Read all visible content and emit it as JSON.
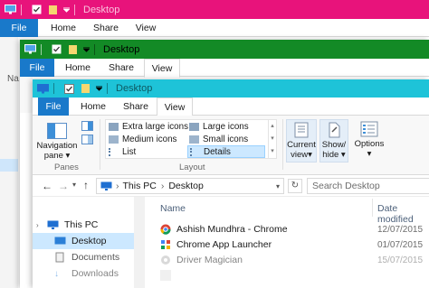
{
  "colors": {
    "pink": "#e8137b",
    "green": "#138a26",
    "cyan": "#1ec3d8",
    "file_tab": "#1979ca",
    "selection": "#cce8ff"
  },
  "back_window": {
    "title": "Desktop",
    "tabs": [
      "File",
      "Home",
      "Share",
      "View"
    ]
  },
  "middle_window": {
    "title": "Desktop",
    "tabs": [
      "File",
      "Home",
      "Share",
      "View"
    ],
    "edge_label": "Na"
  },
  "front_window": {
    "title": "Desktop",
    "tabs": {
      "file": "File",
      "home": "Home",
      "share": "Share",
      "view": "View"
    },
    "panes": {
      "navigation_pane_line1": "Navigation",
      "navigation_pane_line2": "pane",
      "group_label": "Panes"
    },
    "layout": {
      "group_label": "Layout",
      "items": [
        "Extra large icons",
        "Large icons",
        "Medium icons",
        "Small icons",
        "List",
        "Details"
      ],
      "selected": "Details"
    },
    "current_view": {
      "line1": "Current",
      "line2": "view"
    },
    "show_hide": {
      "line1": "Show/",
      "line2": "hide"
    },
    "options": {
      "label": "Options"
    },
    "address": {
      "this_pc": "This PC",
      "desktop": "Desktop",
      "separator": "›"
    },
    "search": {
      "placeholder": "Search Desktop"
    },
    "nav_pane": {
      "items": [
        "This PC",
        "Desktop",
        "Documents",
        "Downloads"
      ],
      "selected": "Desktop"
    },
    "columns": {
      "name": "Name",
      "date": "Date modified"
    },
    "files": [
      {
        "name": "Ashish Mundhra - Chrome",
        "date": "12/07/2015"
      },
      {
        "name": "Chrome App Launcher",
        "date": "01/07/2015"
      },
      {
        "name": "Driver Magician",
        "date": "15/07/2015"
      },
      {
        "name": "",
        "date": ""
      }
    ]
  }
}
